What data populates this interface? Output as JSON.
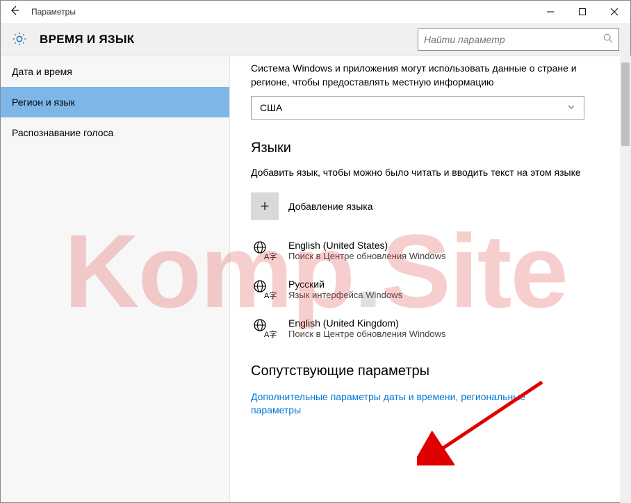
{
  "titlebar": {
    "title": "Параметры"
  },
  "header": {
    "page_title": "ВРЕМЯ И ЯЗЫК",
    "search_placeholder": "Найти параметр"
  },
  "sidebar": {
    "items": [
      {
        "label": "Дата и время",
        "selected": false
      },
      {
        "label": "Регион и язык",
        "selected": true
      },
      {
        "label": "Распознавание голоса",
        "selected": false
      }
    ]
  },
  "content": {
    "region_desc": "Система Windows и приложения могут использовать данные о стране и регионе, чтобы предоставлять местную информацию",
    "region_value": "США",
    "languages_heading": "Языки",
    "languages_desc": "Добавить язык, чтобы можно было читать и вводить текст на этом языке",
    "add_language_label": "Добавление языка",
    "languages": [
      {
        "name": "English (United States)",
        "sub": "Поиск в Центре обновления Windows"
      },
      {
        "name": "Русский",
        "sub": "Язык интерфейса Windows"
      },
      {
        "name": "English (United Kingdom)",
        "sub": "Поиск в Центре обновления Windows"
      }
    ],
    "related_heading": "Сопутствующие параметры",
    "related_link": "Дополнительные параметры даты и времени, региональные параметры"
  },
  "watermark": {
    "part1": "Komp",
    "dot": ".",
    "part2": "Site"
  }
}
